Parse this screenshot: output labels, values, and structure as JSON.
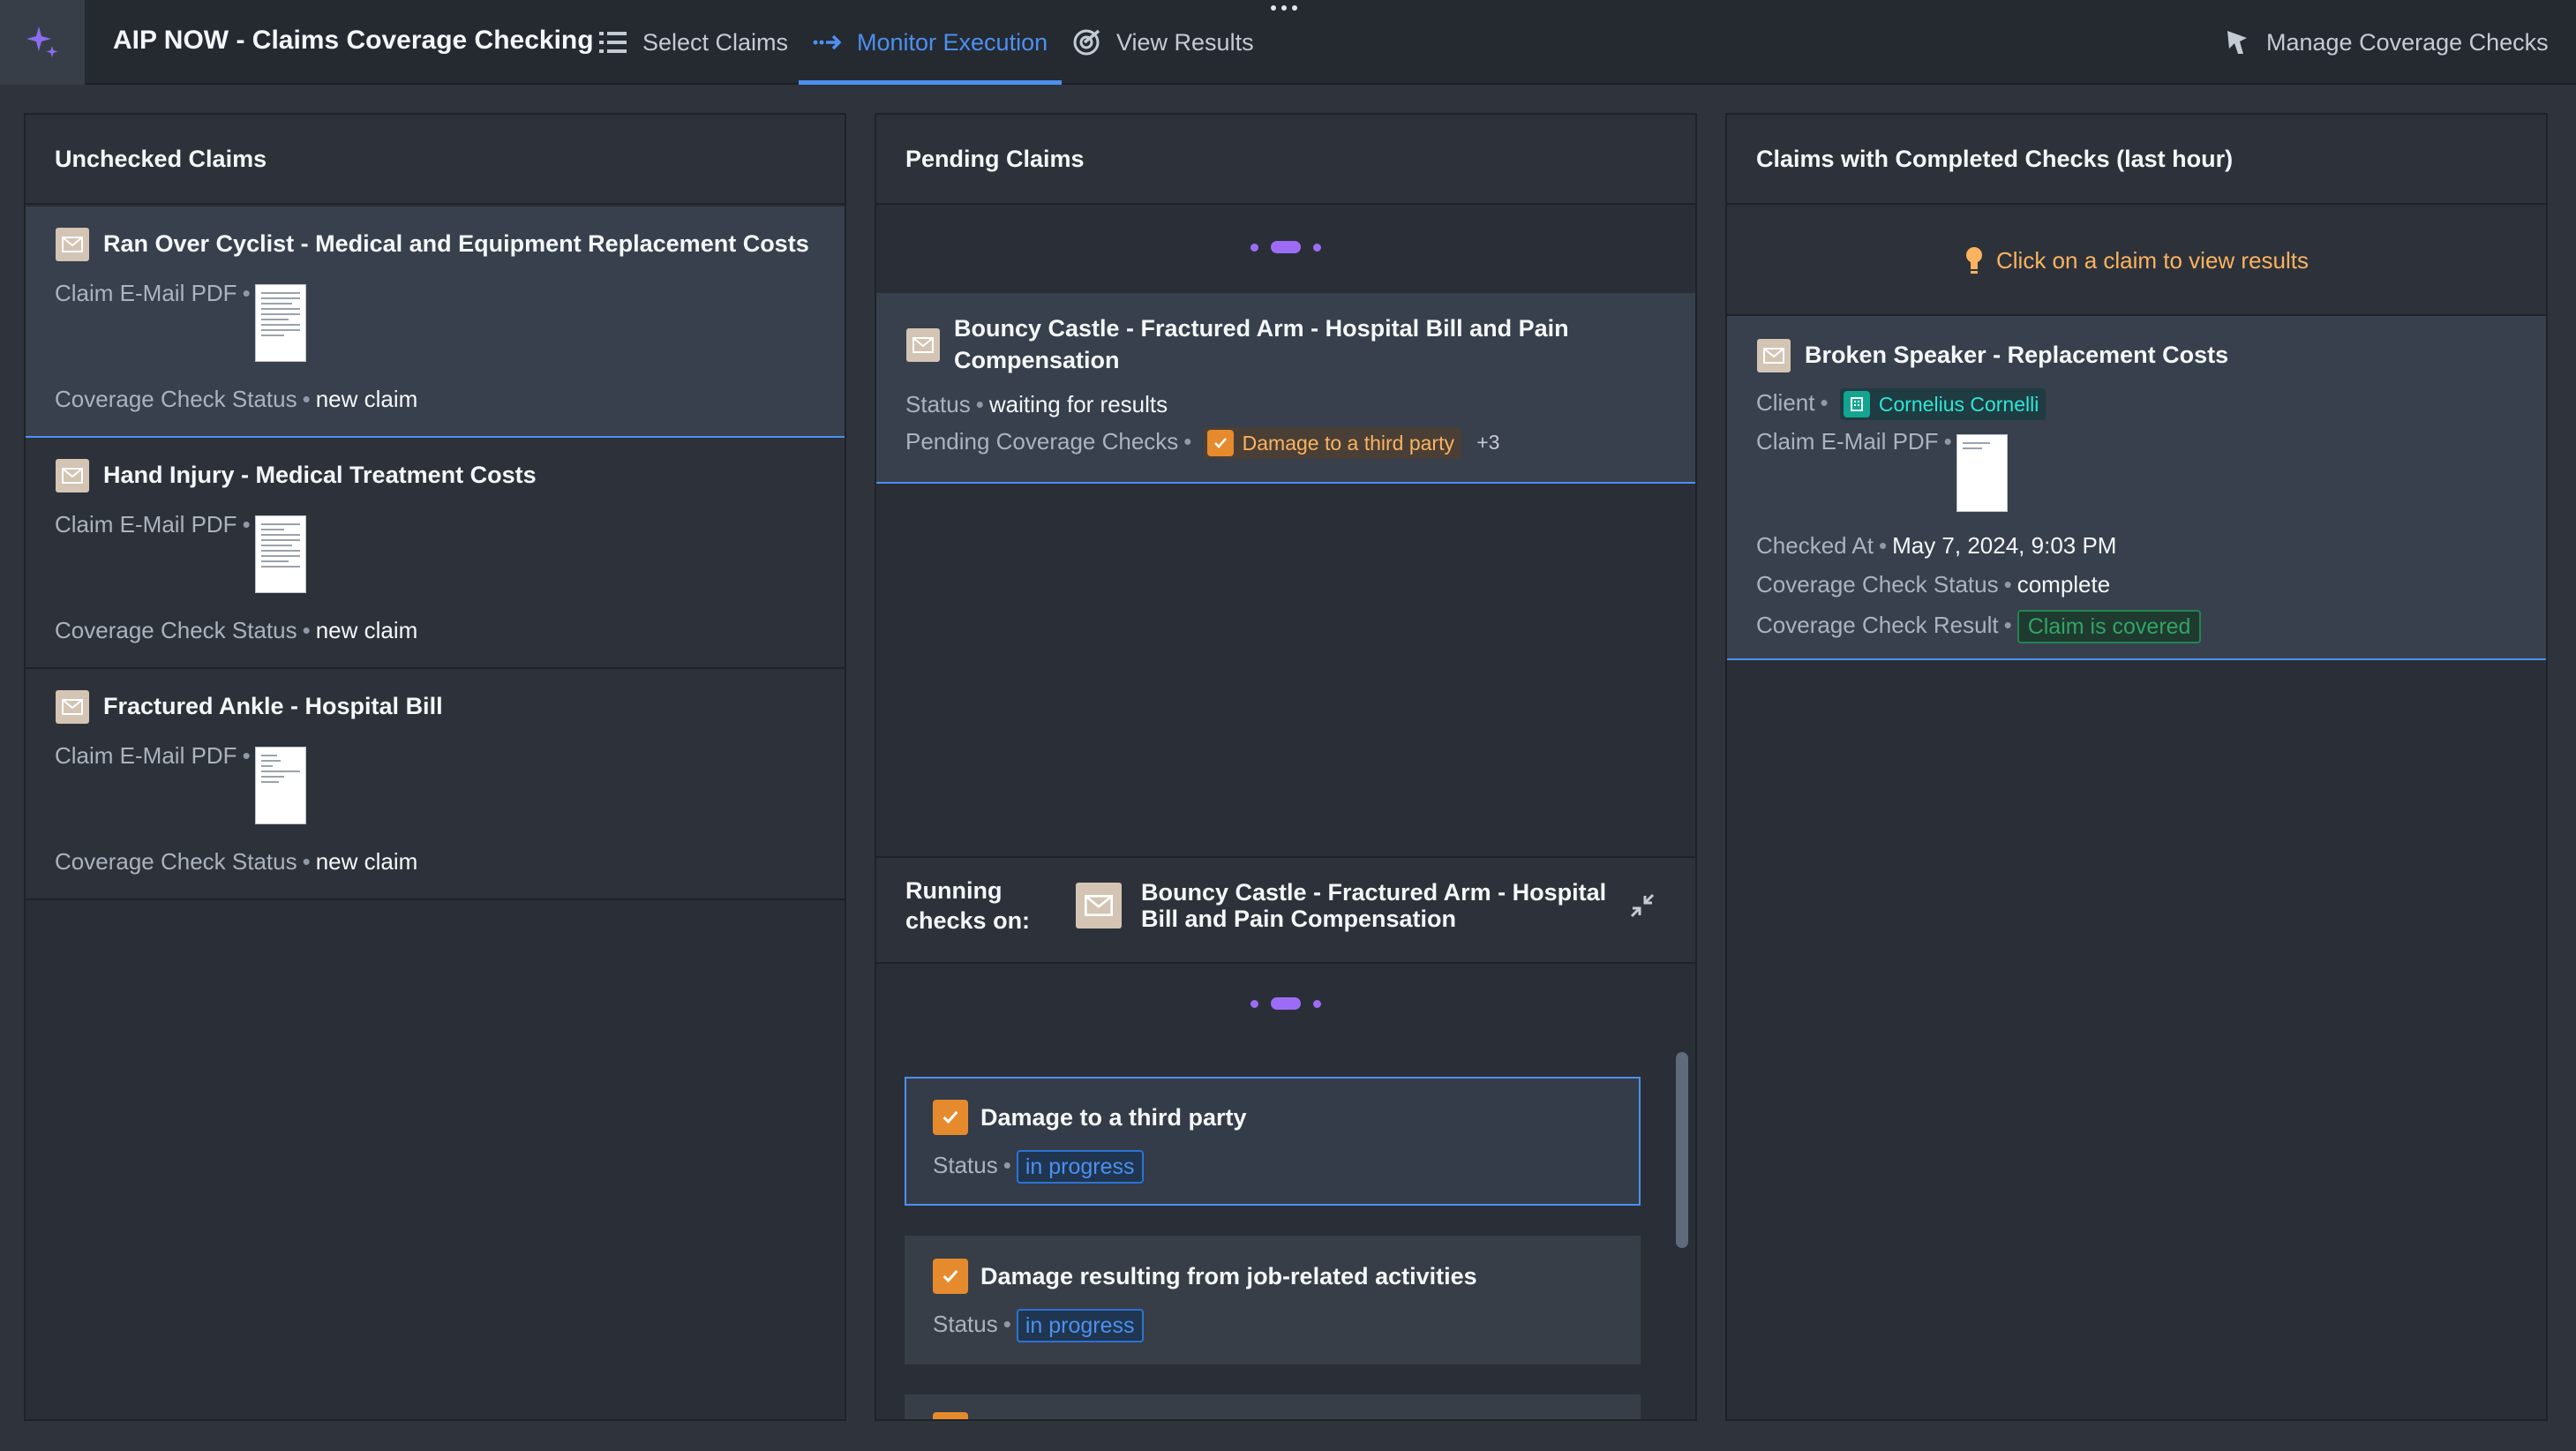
{
  "header": {
    "title": "AIP NOW - Claims Coverage Checking",
    "tabs": [
      {
        "label": "Select Claims",
        "icon": "list-icon"
      },
      {
        "label": "Monitor Execution",
        "icon": "arrow-right-icon",
        "active": true
      },
      {
        "label": "View Results",
        "icon": "target-check-icon"
      }
    ],
    "manage_label": "Manage Coverage Checks"
  },
  "unchecked": {
    "title": "Unchecked Claims",
    "claims": [
      {
        "title": "Ran Over Cyclist - Medical and Equipment Replacement Costs",
        "pdf_label": "Claim E-Mail PDF",
        "status_label": "Coverage Check Status",
        "status": "new claim"
      },
      {
        "title": "Hand Injury - Medical Treatment Costs",
        "pdf_label": "Claim E-Mail PDF",
        "status_label": "Coverage Check Status",
        "status": "new claim"
      },
      {
        "title": "Fractured Ankle - Hospital Bill",
        "pdf_label": "Claim E-Mail PDF",
        "status_label": "Coverage Check Status",
        "status": "new claim"
      }
    ]
  },
  "pending": {
    "title": "Pending Claims",
    "claim": {
      "title": "Bouncy Castle - Fractured Arm - Hospital Bill and Pain Compensation",
      "status_label": "Status",
      "status": "waiting for results",
      "checks_label": "Pending Coverage Checks",
      "check_tag": "Damage to a third party",
      "more": "+3"
    },
    "running_label": "Running checks on:",
    "running_claim": "Bouncy Castle - Fractured Arm - Hospital Bill and Pain Compensation",
    "checks": [
      {
        "title": "Damage to a third party",
        "status_label": "Status",
        "status": "in progress"
      },
      {
        "title": "Damage resulting from job-related activities",
        "status_label": "Status",
        "status": "in progress"
      }
    ]
  },
  "completed": {
    "title": "Claims with Completed Checks (last hour)",
    "hint": "Click on a claim to view results",
    "claim": {
      "title": "Broken Speaker - Replacement Costs",
      "client_label": "Client",
      "client": "Cornelius Cornelli",
      "pdf_label": "Claim E-Mail PDF",
      "checked_at_label": "Checked At",
      "checked_at": "May 7, 2024, 9:03 PM",
      "status_label": "Coverage Check Status",
      "status": "complete",
      "result_label": "Coverage Check Result",
      "result": "Claim is covered"
    }
  },
  "colors": {
    "accent": "#4c90f0",
    "loader": "#9d6cf7",
    "hint": "#fbb360",
    "success": "#32a467"
  }
}
